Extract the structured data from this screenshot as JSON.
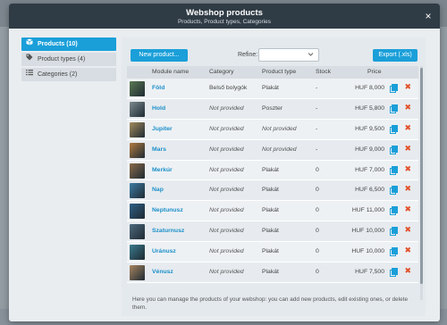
{
  "modal": {
    "title": "Webshop products",
    "subtitle": "Products, Product types, Categories",
    "close_icon": "×"
  },
  "sidebar": {
    "items": [
      {
        "label": "Products (10)",
        "icon": "box-icon",
        "active": true
      },
      {
        "label": "Product types (4)",
        "icon": "tag-icon",
        "active": false
      },
      {
        "label": "Categories (2)",
        "icon": "list-icon",
        "active": false
      }
    ]
  },
  "toolbar": {
    "new_label": "New product...",
    "refine_label": "Refine:",
    "refine_value": "",
    "export_label": "Export (.xls)"
  },
  "table": {
    "headers": {
      "name": "Module name",
      "category": "Category",
      "type": "Product type",
      "stock": "Stock",
      "price": "Price"
    },
    "rows": [
      {
        "name": "Föld",
        "category": "Belső bolygók",
        "type": "Plakát",
        "stock": "-",
        "price": "HUF 8,000",
        "cat_italic": false,
        "type_italic": false,
        "thumb": "#5b7a52"
      },
      {
        "name": "Hold",
        "category": "Not provided",
        "type": "Poszter",
        "stock": "-",
        "price": "HUF 5,800",
        "cat_italic": true,
        "type_italic": false,
        "thumb": "#7c8a8e"
      },
      {
        "name": "Jupiter",
        "category": "Not provided",
        "type": "Not provided",
        "stock": "-",
        "price": "HUF 9,500",
        "cat_italic": true,
        "type_italic": true,
        "thumb": "#a48b5e"
      },
      {
        "name": "Mars",
        "category": "Not provided",
        "type": "Not provided",
        "stock": "-",
        "price": "HUF 9,000",
        "cat_italic": true,
        "type_italic": true,
        "thumb": "#b07a3e"
      },
      {
        "name": "Merkúr",
        "category": "Not provided",
        "type": "Plakát",
        "stock": "0",
        "price": "HUF 7,000",
        "cat_italic": true,
        "type_italic": false,
        "thumb": "#8a6c4a"
      },
      {
        "name": "Nap",
        "category": "Not provided",
        "type": "Plakát",
        "stock": "0",
        "price": "HUF 6,500",
        "cat_italic": true,
        "type_italic": false,
        "thumb": "#3f7da5"
      },
      {
        "name": "Neptunusz",
        "category": "Not provided",
        "type": "Plakát",
        "stock": "0",
        "price": "HUF 11,000",
        "cat_italic": true,
        "type_italic": false,
        "thumb": "#2f5f86"
      },
      {
        "name": "Szaturnusz",
        "category": "Not provided",
        "type": "Plakát",
        "stock": "0",
        "price": "HUF 10,000",
        "cat_italic": true,
        "type_italic": false,
        "thumb": "#4e6a7e"
      },
      {
        "name": "Uránusz",
        "category": "Not provided",
        "type": "Plakát",
        "stock": "0",
        "price": "HUF 10,000",
        "cat_italic": true,
        "type_italic": false,
        "thumb": "#3a7a8c"
      },
      {
        "name": "Vénusz",
        "category": "Not provided",
        "type": "Plakát",
        "stock": "0",
        "price": "HUF 7,500",
        "cat_italic": true,
        "type_italic": false,
        "thumb": "#a88560"
      }
    ]
  },
  "footer": {
    "text": "Here you can manage the products of your webshop: you can add new products, edit existing ones, or delete them."
  },
  "colors": {
    "accent": "#1a9fd9",
    "header_bg": "#2f3b45",
    "delete": "#e2512a"
  }
}
